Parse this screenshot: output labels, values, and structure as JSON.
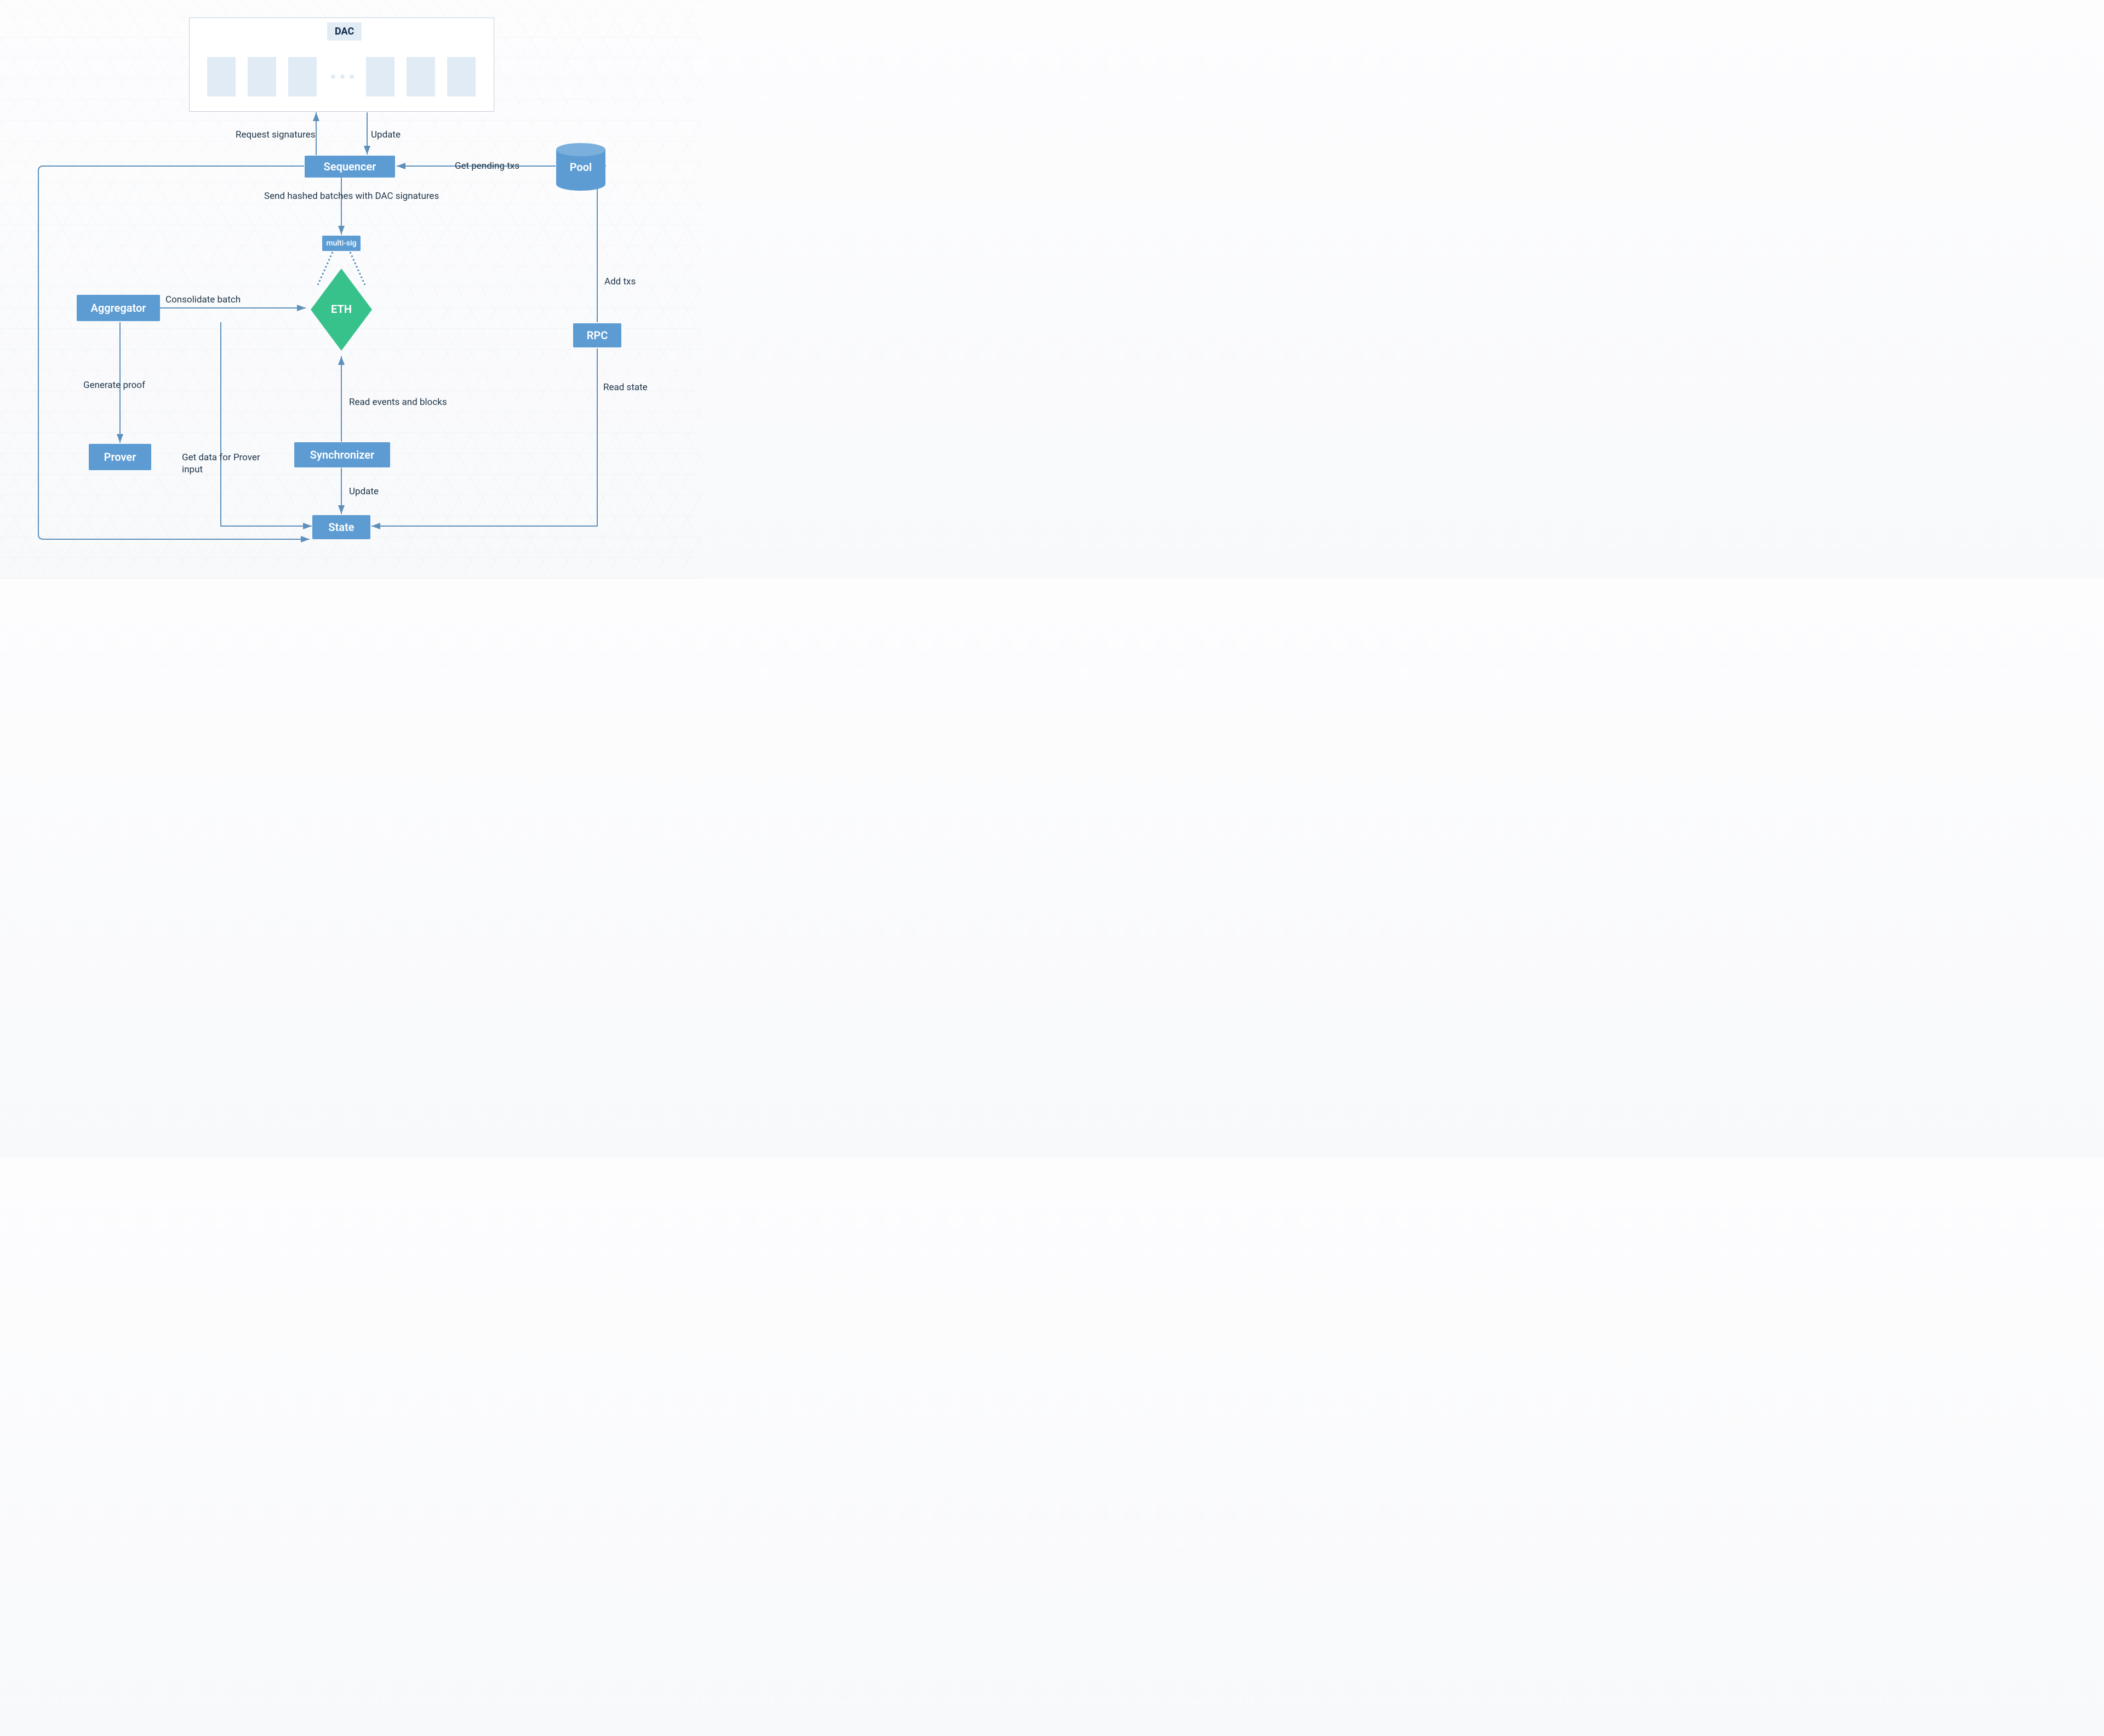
{
  "nodes": {
    "dac": "DAC",
    "sequencer": "Sequencer",
    "pool": "Pool",
    "multisig": "multi-sig",
    "eth": "ETH",
    "aggregator": "Aggregator",
    "prover": "Prover",
    "synchronizer": "Synchronizer",
    "state": "State",
    "rpc": "RPC"
  },
  "edges": {
    "request_signatures": "Request signatures",
    "update_dac": "Update",
    "get_pending_txs": "Get pending txs",
    "send_hashed": "Send hashed batches with DAC signatures",
    "consolidate_batch": "Consolidate batch",
    "generate_proof": "Generate proof",
    "get_data_prover": "Get data for Prover input",
    "read_events_blocks": "Read events and blocks",
    "sync_update": "Update",
    "add_txs": "Add txs",
    "read_state": "Read state"
  },
  "diagram": {
    "description": "Architecture flow diagram showing DAC, Sequencer, Pool, multi-sig, ETH, Aggregator, Prover, Synchronizer, State and RPC interactions",
    "colors": {
      "node_blue": "#5d9cd3",
      "eth_green": "#38c28b",
      "edge_stroke": "#5d90ba",
      "text_dark": "#1d3448",
      "dac_bg": "#e0ebf5"
    }
  }
}
